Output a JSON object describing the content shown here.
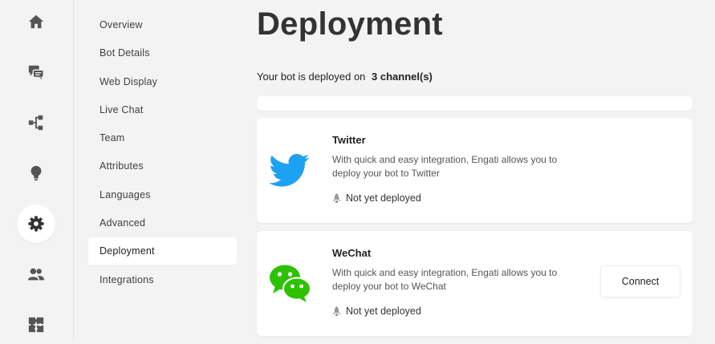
{
  "colors": {
    "rail_icon": "#555555",
    "twitter_blue": "#1da1f2",
    "wechat_green": "#2dc100",
    "status_icon": "#999999"
  },
  "rail": {
    "items": [
      {
        "icon": "home-icon"
      },
      {
        "icon": "chat-icon"
      },
      {
        "icon": "flow-icon"
      },
      {
        "icon": "bulb-icon"
      },
      {
        "icon": "gear-icon",
        "active": true
      },
      {
        "icon": "users-icon"
      },
      {
        "icon": "puzzle-icon"
      }
    ]
  },
  "subnav": {
    "items": [
      {
        "label": "Overview"
      },
      {
        "label": "Bot Details"
      },
      {
        "label": "Web Display"
      },
      {
        "label": "Live Chat"
      },
      {
        "label": "Team"
      },
      {
        "label": "Attributes"
      },
      {
        "label": "Languages"
      },
      {
        "label": "Advanced"
      },
      {
        "label": "Deployment",
        "active": true
      },
      {
        "label": "Integrations"
      }
    ]
  },
  "main": {
    "title": "Deployment",
    "summary_prefix": "Your bot is deployed on",
    "summary_count": "3 channel(s)",
    "channels": [
      {
        "name": "Twitter",
        "icon": "twitter-icon",
        "description": "With quick and easy integration, Engati allows you to deploy your bot to Twitter",
        "status": "Not yet deployed"
      },
      {
        "name": "WeChat",
        "icon": "wechat-icon",
        "description": "With quick and easy integration, Engati allows you to deploy your bot to WeChat",
        "status": "Not yet deployed",
        "action_label": "Connect"
      }
    ]
  }
}
